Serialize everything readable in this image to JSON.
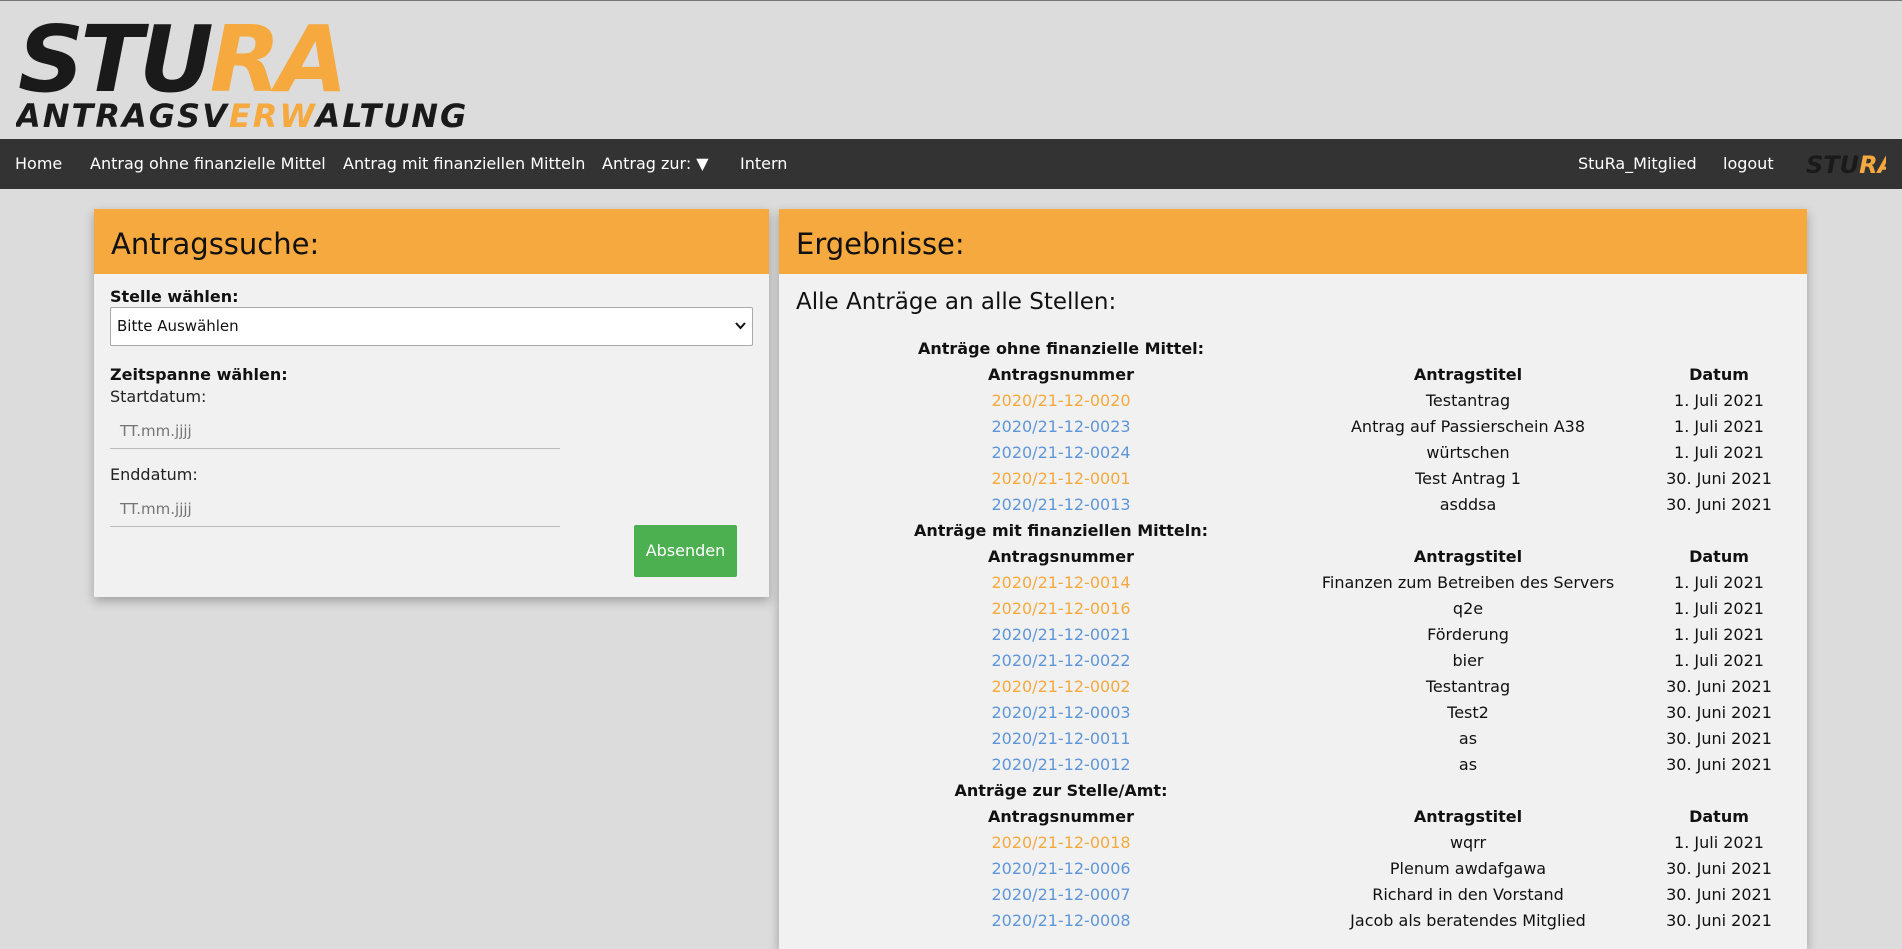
{
  "header": {
    "logo_text_main": "STURA",
    "logo_text_sub": "ANTRAGSVERWALTUNG",
    "colors": {
      "dark": "#1a1a1a",
      "accent": "#f5a93e"
    }
  },
  "nav": {
    "home": "Home",
    "antrag_ohne": "Antrag ohne finanzielle Mittel",
    "antrag_mit": "Antrag mit finanziellen Mitteln",
    "antrag_zur": "Antrag zur: ▼",
    "intern": "Intern",
    "user": "StuRa_Mitglied",
    "logout": "logout",
    "logo_text": "STURA"
  },
  "search": {
    "title": "Antragssuche:",
    "stelle_label": "Stelle wählen:",
    "stelle_value": "Bitte Auswählen",
    "zeitspanne_label": "Zeitspanne wählen:",
    "start_label": "Startdatum:",
    "start_placeholder": "TT.mm.jjjj",
    "end_label": "Enddatum:",
    "end_placeholder": "TT.mm.jjjj",
    "submit": "Absenden"
  },
  "results": {
    "title": "Ergebnisse:",
    "subtitle": "Alle Anträge an alle Stellen:",
    "columns": {
      "nummer": "Antragsnummer",
      "titel": "Antragstitel",
      "datum": "Datum"
    },
    "sections": [
      {
        "title": "Anträge ohne finanzielle Mittel:",
        "rows": [
          {
            "nummer": "2020/21-12-0020",
            "titel": "Testantrag",
            "datum": "1. Juli 2021",
            "color": "orange"
          },
          {
            "nummer": "2020/21-12-0023",
            "titel": "Antrag auf Passierschein A38",
            "datum": "1. Juli 2021",
            "color": "blue"
          },
          {
            "nummer": "2020/21-12-0024",
            "titel": "würtschen",
            "datum": "1. Juli 2021",
            "color": "blue"
          },
          {
            "nummer": "2020/21-12-0001",
            "titel": "Test Antrag 1",
            "datum": "30. Juni 2021",
            "color": "orange"
          },
          {
            "nummer": "2020/21-12-0013",
            "titel": "asddsa",
            "datum": "30. Juni 2021",
            "color": "blue"
          }
        ]
      },
      {
        "title": "Anträge mit finanziellen Mitteln:",
        "rows": [
          {
            "nummer": "2020/21-12-0014",
            "titel": "Finanzen zum Betreiben des Servers",
            "datum": "1. Juli 2021",
            "color": "orange"
          },
          {
            "nummer": "2020/21-12-0016",
            "titel": "q2e",
            "datum": "1. Juli 2021",
            "color": "orange"
          },
          {
            "nummer": "2020/21-12-0021",
            "titel": "Förderung",
            "datum": "1. Juli 2021",
            "color": "blue"
          },
          {
            "nummer": "2020/21-12-0022",
            "titel": "bier",
            "datum": "1. Juli 2021",
            "color": "blue"
          },
          {
            "nummer": "2020/21-12-0002",
            "titel": "Testantrag",
            "datum": "30. Juni 2021",
            "color": "orange"
          },
          {
            "nummer": "2020/21-12-0003",
            "titel": "Test2",
            "datum": "30. Juni 2021",
            "color": "blue"
          },
          {
            "nummer": "2020/21-12-0011",
            "titel": "as",
            "datum": "30. Juni 2021",
            "color": "blue"
          },
          {
            "nummer": "2020/21-12-0012",
            "titel": "as",
            "datum": "30. Juni 2021",
            "color": "blue"
          }
        ]
      },
      {
        "title": "Anträge zur Stelle/Amt:",
        "rows": [
          {
            "nummer": "2020/21-12-0018",
            "titel": "wqrr",
            "datum": "1. Juli 2021",
            "color": "orange"
          },
          {
            "nummer": "2020/21-12-0006",
            "titel": "Plenum awdafgawa",
            "datum": "30. Juni 2021",
            "color": "blue"
          },
          {
            "nummer": "2020/21-12-0007",
            "titel": "Richard in den Vorstand",
            "datum": "30. Juni 2021",
            "color": "blue"
          },
          {
            "nummer": "2020/21-12-0008",
            "titel": "Jacob als beratendes Mitglied",
            "datum": "30. Juni 2021",
            "color": "blue"
          }
        ]
      }
    ]
  }
}
